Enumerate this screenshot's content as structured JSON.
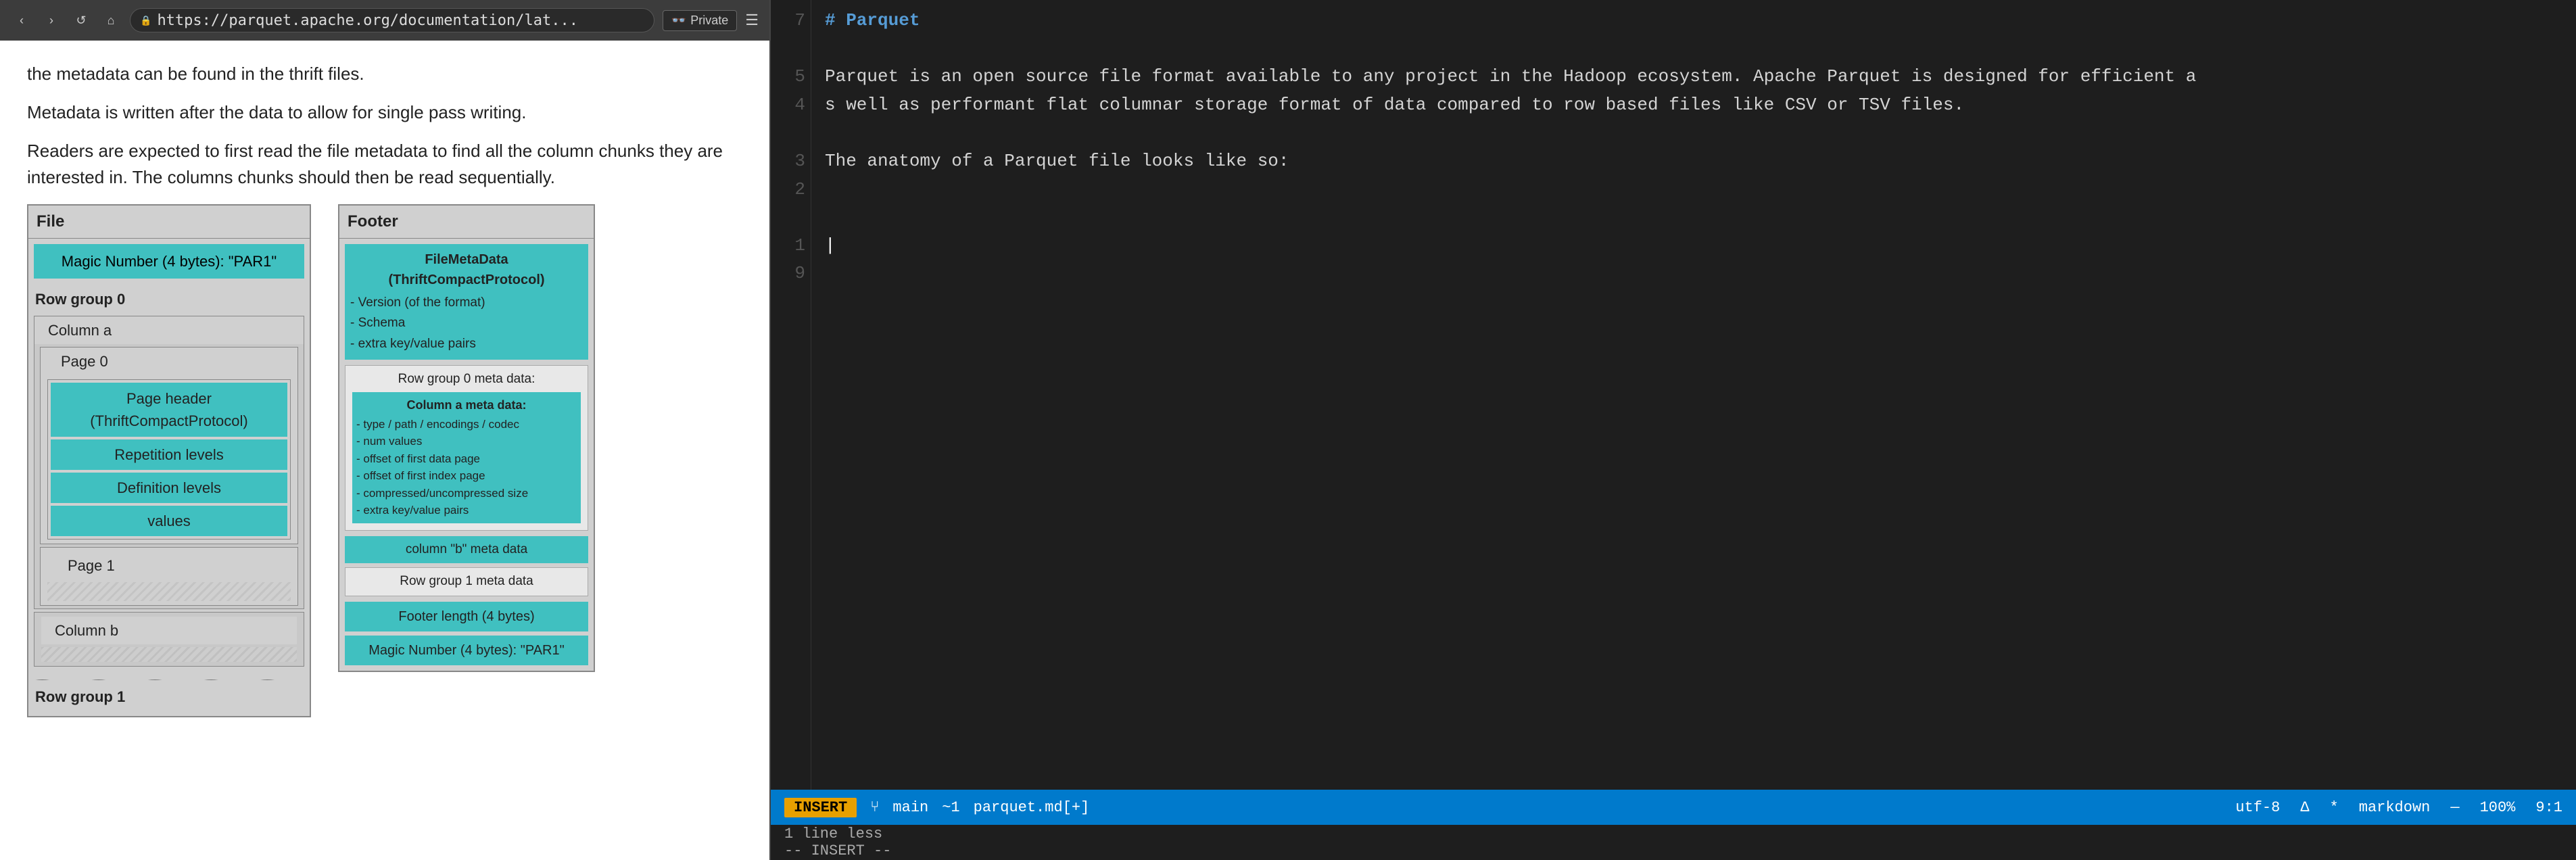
{
  "browser": {
    "url": "https://parquet.apache.org/documentation/lat...",
    "private_label": "Private",
    "shield_icon": "🛡",
    "glasses_icon": "👓"
  },
  "webpage": {
    "paragraphs": [
      "the metadata can be found in the thrift files.",
      "Metadata is written after the data to allow for single pass writing.",
      "Readers are expected to first read the file metadata to find all the column chunks they are interested in. The columns chunks should then be read sequentially."
    ],
    "diagram": {
      "file_title": "File",
      "magic_number_top": "Magic Number (4 bytes): \"PAR1\"",
      "row_group_0": "Row group 0",
      "column_a": "Column a",
      "page_0": "Page 0",
      "page_header": "Page header (ThriftCompactProtocol)",
      "rep_levels": "Repetition levels",
      "def_levels": "Definition levels",
      "values": "values",
      "page_1": "Page 1",
      "column_b": "Column b",
      "row_group_1": "Row group 1",
      "footer_title": "Footer",
      "filemetadata_title": "FileMetaData (ThriftCompactProtocol)",
      "filemetadata_items": [
        "- Version (of the format)",
        "- Schema",
        "- extra key/value pairs"
      ],
      "row_group_0_meta": "Row group 0 meta data:",
      "col_a_meta_title": "Column a meta data:",
      "col_a_meta_items": [
        "- type / path / encodings / codec",
        "- num values",
        "- offset of first data page",
        "- offset of first index page",
        "- compressed/uncompressed size",
        "- extra key/value pairs"
      ],
      "col_b_meta": "column \"b\" meta data",
      "row_group_1_meta": "Row group 1 meta data",
      "footer_length": "Footer length (4 bytes)",
      "magic_number_footer": "Magic Number (4 bytes): \"PAR1\""
    }
  },
  "editor": {
    "line_numbers": [
      "7",
      "",
      "5",
      "4",
      "",
      "3",
      "2",
      "",
      "1",
      "9"
    ],
    "lines": [
      "# Parquet",
      "",
      "Parquet is an open source file format available to any project in the Hadoop ecosystem. Apache Parquet is designed for efficient a",
      "s well as performant flat columnar storage format of data compared to row based files like CSV or TSV files.",
      "",
      "The anatomy of a Parquet file looks like so:",
      "",
      "",
      ""
    ],
    "status_bar": {
      "mode": "INSERT",
      "branch": "main",
      "line_count": "~1",
      "filename": "parquet.md[+]",
      "encoding": "utf-8",
      "delta": "Δ",
      "asterisk": "*",
      "filetype": "markdown",
      "zoom": "100%",
      "position": "9:1"
    },
    "bottom": {
      "line1": "1 line less",
      "line2": "-- INSERT --"
    }
  }
}
